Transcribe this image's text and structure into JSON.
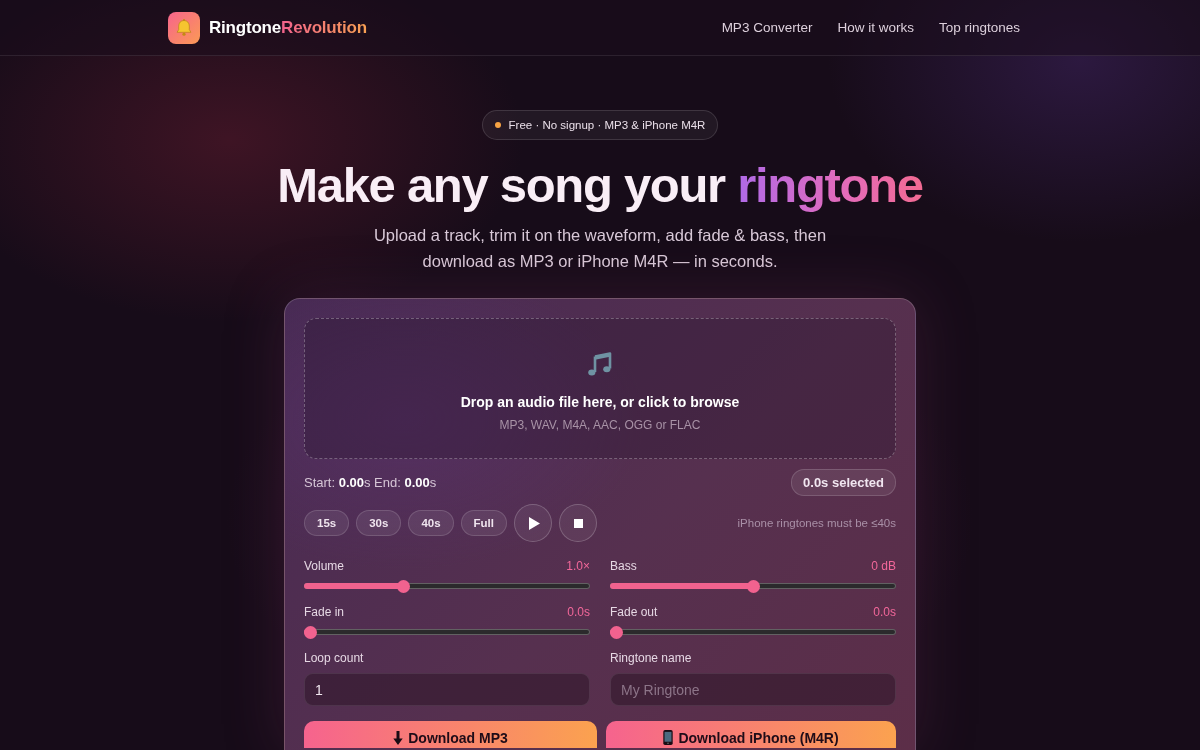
{
  "header": {
    "brand": {
      "first": "Ringtone",
      "second": "Revolution"
    },
    "nav": [
      {
        "label": "MP3 Converter"
      },
      {
        "label": "How it works"
      },
      {
        "label": "Top ringtones"
      }
    ]
  },
  "hero": {
    "badge": "Free · No signup · MP3 & iPhone M4R",
    "headline": "Make any song your",
    "headline_highlight": "ringtone",
    "subtitle": "Upload a track, trim it on the waveform, add fade & bass, then download as MP3 or iPhone M4R — in seconds."
  },
  "editor": {
    "dropzone": {
      "title": "Drop an audio file here, or click to browse",
      "formats": "MP3, WAV, M4A, AAC, OGG or FLAC"
    },
    "selection": {
      "times": "Start: **0.00**s End: **0.00**s",
      "duration": "0.0s selected"
    },
    "presets": [
      {
        "label": "15s"
      },
      {
        "label": "30s"
      },
      {
        "label": "40s"
      },
      {
        "label": "Full"
      }
    ],
    "transport": [
      {
        "kind": "play"
      },
      {
        "kind": "stop"
      }
    ],
    "hint": "iPhone ringtones must be ≤40s",
    "sliders": [
      {
        "label": "Volume",
        "reading": "1.0×",
        "level": 0.34
      },
      {
        "label": "Bass",
        "reading": "0 dB",
        "level": 0.5
      },
      {
        "label": "Fade in",
        "reading": "0.0s",
        "level": 0
      },
      {
        "label": "Fade out",
        "reading": "0.0s",
        "level": 0
      }
    ],
    "fields": [
      {
        "label": "Loop count",
        "value": "1"
      },
      {
        "label": "Ringtone name",
        "placeholder": "My Ringtone"
      }
    ],
    "downloads": [
      {
        "kind": "mp3",
        "label": "Download MP3"
      },
      {
        "kind": "phone",
        "label": "Download iPhone (M4R)"
      }
    ]
  }
}
